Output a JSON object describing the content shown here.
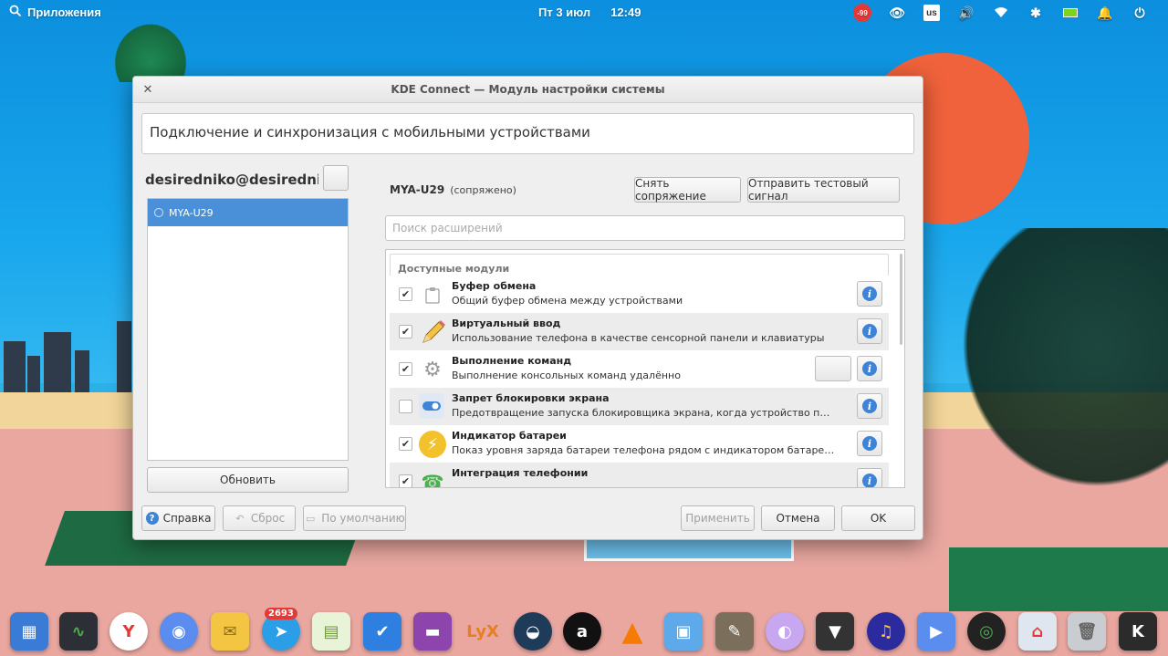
{
  "top_panel": {
    "apps_label": "Приложения",
    "date": "Пт  3 июл",
    "time": "12:49",
    "keyboard_layout": "us",
    "recorder_badge": "-99"
  },
  "window": {
    "title": "KDE Connect — Модуль настройки системы",
    "header": "Подключение и синхронизация с мобильными устройствами",
    "username": "desiredniko@desiredniko",
    "devices": [
      "MYA-U29"
    ],
    "refresh_label": "Обновить",
    "device": {
      "name": "MYA-U29",
      "status": "(сопряжено)",
      "unpair_label": "Снять сопряжение",
      "ping_label": "Отправить тестовый сигнал"
    },
    "search_placeholder": "Поиск расширений",
    "section_label": "Доступные модули",
    "plugins": [
      {
        "name": "Буфер обмена",
        "desc": "Общий буфер обмена между устройствами",
        "checked": true,
        "icon": "clipboard-icon"
      },
      {
        "name": "Виртуальный ввод",
        "desc": "Использование телефона в качестве сенсорной панели и клавиатуры",
        "checked": true,
        "icon": "pencil-icon"
      },
      {
        "name": "Выполнение команд",
        "desc": "Выполнение консольных команд удалённо",
        "checked": true,
        "icon": "gears-icon"
      },
      {
        "name": "Запрет блокировки экрана",
        "desc": "Предотвращение запуска блокировщика экрана, когда устройство подклю...",
        "checked": false,
        "icon": "toggle-icon"
      },
      {
        "name": "Индикатор батареи",
        "desc": "Показ уровня заряда батареи телефона рядом с индикатором батареи ком...",
        "checked": true,
        "icon": "battery-bolt-icon"
      },
      {
        "name": "Интеграция телефонии",
        "desc": "",
        "checked": true,
        "icon": "phone-icon"
      }
    ],
    "buttons": {
      "help": "Справка",
      "reset": "Сброс",
      "defaults": "По умолчанию",
      "apply": "Применить",
      "cancel": "Отмена",
      "ok": "OK"
    }
  },
  "dock": {
    "telegram_badge": "2693"
  },
  "colors": {
    "accent": "#4a90d9",
    "sun": "#f0623b",
    "sky": "#18a6ec"
  }
}
